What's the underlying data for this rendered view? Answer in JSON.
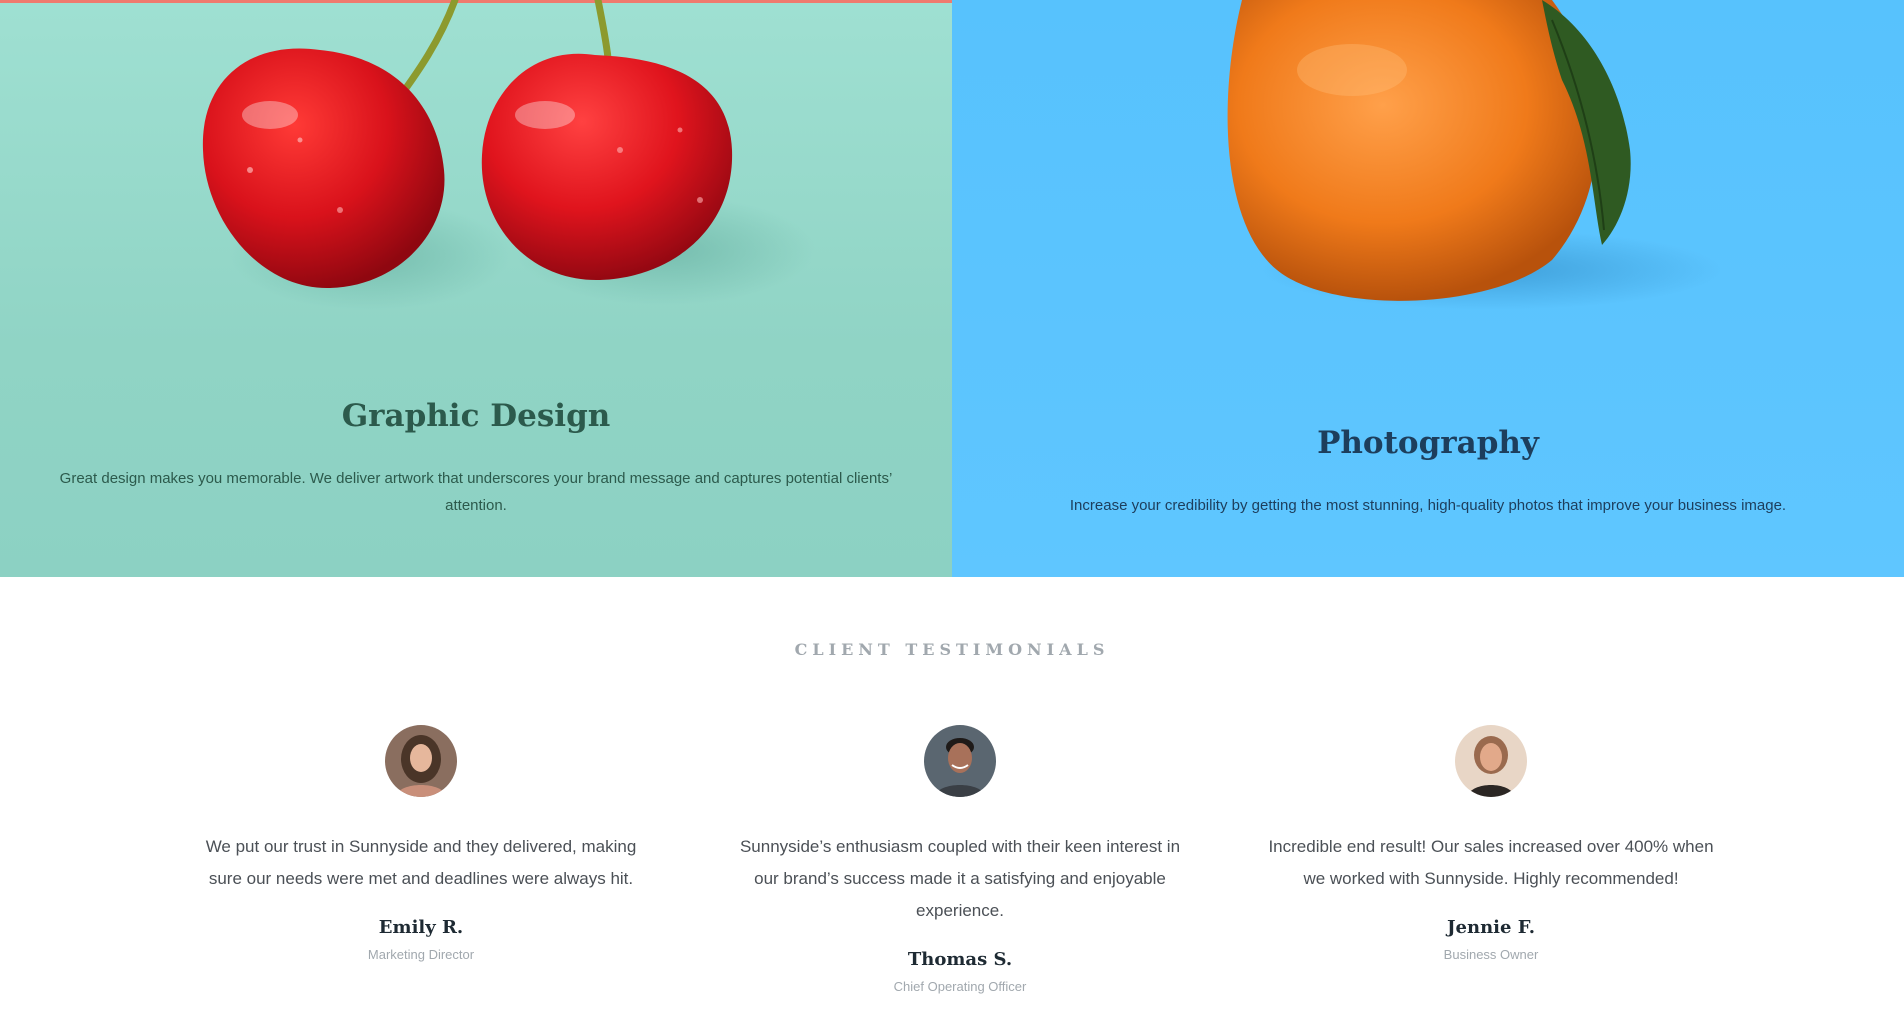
{
  "services": {
    "graphic_design": {
      "title": "Graphic Design",
      "description": "Great design makes you memorable. We deliver artwork that underscores your brand message and captures potential clients’ attention.",
      "background_color": "#9fe0d2",
      "image_subject": "two red cherries"
    },
    "photography": {
      "title": "Photography",
      "description": "Increase your credibility by getting the most stunning, high-quality photos that improve your business image.",
      "background_color": "#5fc6ff",
      "image_subject": "an orange with a leaf"
    }
  },
  "testimonials": {
    "heading": "CLIENT TESTIMONIALS",
    "items": [
      {
        "quote": "We put our trust in Sunnyside and they delivered, making sure our needs were met and deadlines were always hit.",
        "name": "Emily R.",
        "role": "Marketing Director"
      },
      {
        "quote": "Sunnyside’s enthusiasm coupled with their keen interest in our brand’s success made it a satisfying and enjoyable experience.",
        "name": "Thomas S.",
        "role": "Chief Operating Officer"
      },
      {
        "quote": "Incredible end result! Our sales increased over 400% when we worked with Sunnyside. Highly recommended!",
        "name": "Jennie F.",
        "role": "Business Owner"
      }
    ]
  }
}
